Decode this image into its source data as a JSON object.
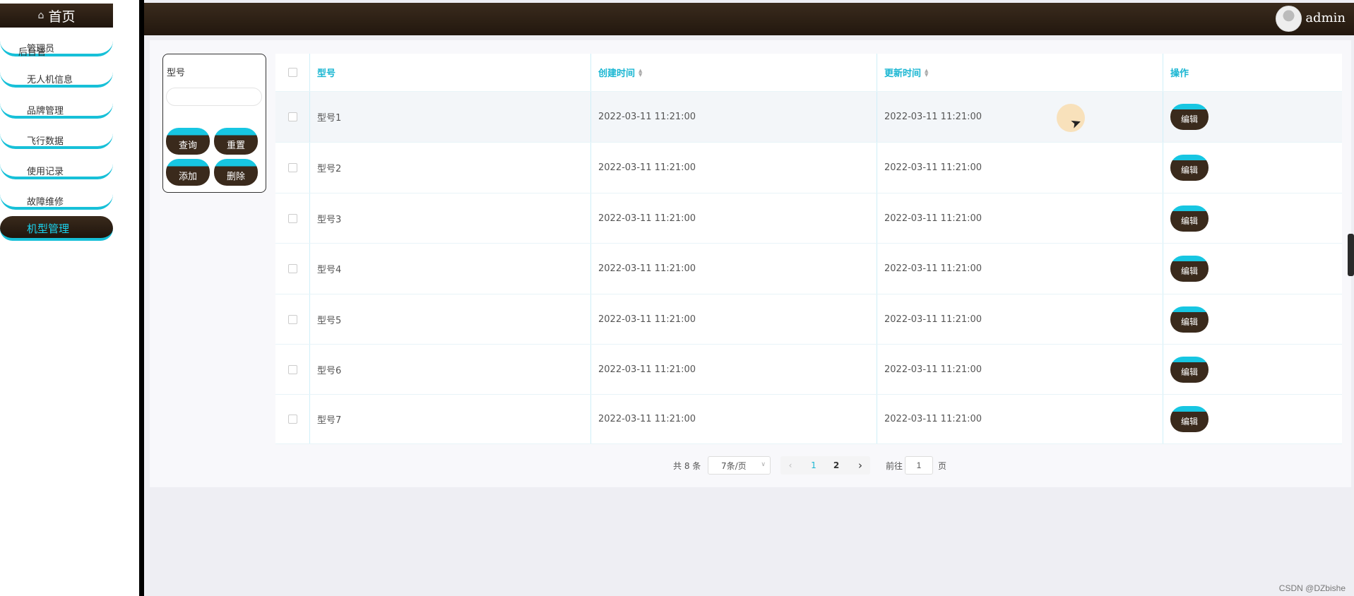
{
  "sidebar": {
    "home_label": "首页",
    "overlap_label": "管理员",
    "overlap_ghost": "后台管",
    "items": [
      {
        "label": "无人机信息"
      },
      {
        "label": "品牌管理"
      },
      {
        "label": "飞行数据"
      },
      {
        "label": "使用记录"
      },
      {
        "label": "故障维修"
      },
      {
        "label": "机型管理"
      }
    ]
  },
  "header": {
    "username": "admin"
  },
  "search": {
    "field_label": "型号",
    "input_value": "",
    "buttons": {
      "query": "查询",
      "reset": "重置",
      "add": "添加",
      "delete": "删除"
    }
  },
  "table": {
    "columns": [
      "型号",
      "创建时间",
      "更新时间",
      "操作"
    ],
    "rows": [
      {
        "model": "型号1",
        "created": "2022-03-11 11:21:00",
        "updated": "2022-03-11 11:21:00",
        "action": "编辑"
      },
      {
        "model": "型号2",
        "created": "2022-03-11 11:21:00",
        "updated": "2022-03-11 11:21:00",
        "action": "编辑"
      },
      {
        "model": "型号3",
        "created": "2022-03-11 11:21:00",
        "updated": "2022-03-11 11:21:00",
        "action": "编辑"
      },
      {
        "model": "型号4",
        "created": "2022-03-11 11:21:00",
        "updated": "2022-03-11 11:21:00",
        "action": "编辑"
      },
      {
        "model": "型号5",
        "created": "2022-03-11 11:21:00",
        "updated": "2022-03-11 11:21:00",
        "action": "编辑"
      },
      {
        "model": "型号6",
        "created": "2022-03-11 11:21:00",
        "updated": "2022-03-11 11:21:00",
        "action": "编辑"
      },
      {
        "model": "型号7",
        "created": "2022-03-11 11:21:00",
        "updated": "2022-03-11 11:21:00",
        "action": "编辑"
      }
    ]
  },
  "pagination": {
    "total_text": "共 8 条",
    "page_size": "7条/页",
    "pages": [
      "1",
      "2"
    ],
    "current_page": "1",
    "goto_label": "前往",
    "goto_value": "1",
    "page_suffix": "页"
  },
  "watermark": "CSDN @DZbishe",
  "colors": {
    "accent": "#17c0d8",
    "dark_brown": "#2e2115",
    "header_text": "#19b6d2"
  }
}
